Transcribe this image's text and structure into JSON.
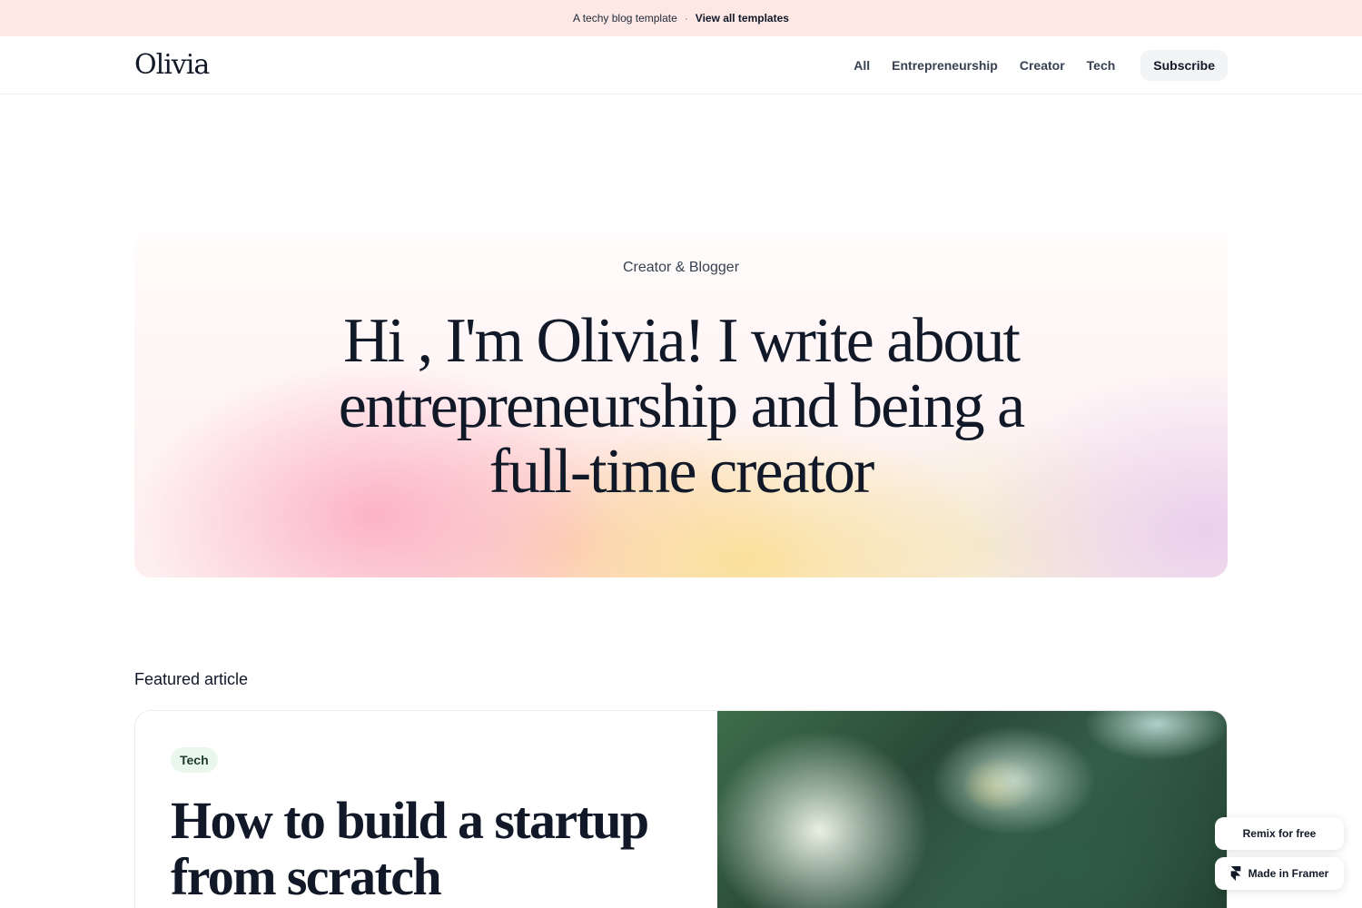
{
  "banner": {
    "text": "A techy blog template",
    "separator": "·",
    "link_label": "View all templates"
  },
  "header": {
    "logo": "Olivia",
    "nav": [
      {
        "label": "All"
      },
      {
        "label": "Entrepreneurship"
      },
      {
        "label": "Creator"
      },
      {
        "label": "Tech"
      }
    ],
    "subscribe_label": "Subscribe"
  },
  "hero": {
    "eyebrow": "Creator & Blogger",
    "title": "Hi , I'm Olivia! I write about entrepreneurship and being a full-time creator"
  },
  "featured": {
    "section_label": "Featured article",
    "tag": "Tech",
    "title": "How to build a startup from scratch"
  },
  "badges": {
    "remix": "Remix for free",
    "made_in": "Made in Framer"
  },
  "colors": {
    "banner_bg": "#fde8e6",
    "text_primary": "#111827",
    "tag_bg": "#eaf7ec",
    "subscribe_bg": "#f3f4f6"
  },
  "icons": [
    "framer-logo-icon"
  ]
}
